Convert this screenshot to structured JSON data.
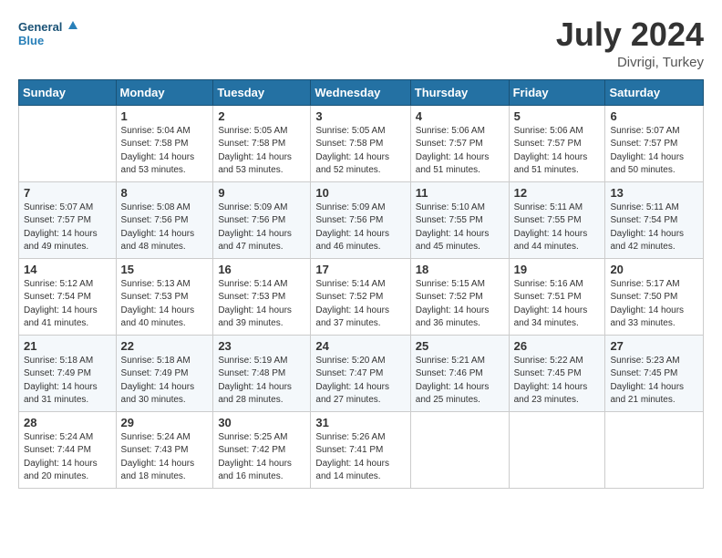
{
  "header": {
    "logo_line1": "General",
    "logo_line2": "Blue",
    "month_year": "July 2024",
    "location": "Divrigi, Turkey"
  },
  "weekdays": [
    "Sunday",
    "Monday",
    "Tuesday",
    "Wednesday",
    "Thursday",
    "Friday",
    "Saturday"
  ],
  "weeks": [
    [
      {
        "day": "",
        "info": ""
      },
      {
        "day": "1",
        "info": "Sunrise: 5:04 AM\nSunset: 7:58 PM\nDaylight: 14 hours\nand 53 minutes."
      },
      {
        "day": "2",
        "info": "Sunrise: 5:05 AM\nSunset: 7:58 PM\nDaylight: 14 hours\nand 53 minutes."
      },
      {
        "day": "3",
        "info": "Sunrise: 5:05 AM\nSunset: 7:58 PM\nDaylight: 14 hours\nand 52 minutes."
      },
      {
        "day": "4",
        "info": "Sunrise: 5:06 AM\nSunset: 7:57 PM\nDaylight: 14 hours\nand 51 minutes."
      },
      {
        "day": "5",
        "info": "Sunrise: 5:06 AM\nSunset: 7:57 PM\nDaylight: 14 hours\nand 51 minutes."
      },
      {
        "day": "6",
        "info": "Sunrise: 5:07 AM\nSunset: 7:57 PM\nDaylight: 14 hours\nand 50 minutes."
      }
    ],
    [
      {
        "day": "7",
        "info": "Sunrise: 5:07 AM\nSunset: 7:57 PM\nDaylight: 14 hours\nand 49 minutes."
      },
      {
        "day": "8",
        "info": "Sunrise: 5:08 AM\nSunset: 7:56 PM\nDaylight: 14 hours\nand 48 minutes."
      },
      {
        "day": "9",
        "info": "Sunrise: 5:09 AM\nSunset: 7:56 PM\nDaylight: 14 hours\nand 47 minutes."
      },
      {
        "day": "10",
        "info": "Sunrise: 5:09 AM\nSunset: 7:56 PM\nDaylight: 14 hours\nand 46 minutes."
      },
      {
        "day": "11",
        "info": "Sunrise: 5:10 AM\nSunset: 7:55 PM\nDaylight: 14 hours\nand 45 minutes."
      },
      {
        "day": "12",
        "info": "Sunrise: 5:11 AM\nSunset: 7:55 PM\nDaylight: 14 hours\nand 44 minutes."
      },
      {
        "day": "13",
        "info": "Sunrise: 5:11 AM\nSunset: 7:54 PM\nDaylight: 14 hours\nand 42 minutes."
      }
    ],
    [
      {
        "day": "14",
        "info": "Sunrise: 5:12 AM\nSunset: 7:54 PM\nDaylight: 14 hours\nand 41 minutes."
      },
      {
        "day": "15",
        "info": "Sunrise: 5:13 AM\nSunset: 7:53 PM\nDaylight: 14 hours\nand 40 minutes."
      },
      {
        "day": "16",
        "info": "Sunrise: 5:14 AM\nSunset: 7:53 PM\nDaylight: 14 hours\nand 39 minutes."
      },
      {
        "day": "17",
        "info": "Sunrise: 5:14 AM\nSunset: 7:52 PM\nDaylight: 14 hours\nand 37 minutes."
      },
      {
        "day": "18",
        "info": "Sunrise: 5:15 AM\nSunset: 7:52 PM\nDaylight: 14 hours\nand 36 minutes."
      },
      {
        "day": "19",
        "info": "Sunrise: 5:16 AM\nSunset: 7:51 PM\nDaylight: 14 hours\nand 34 minutes."
      },
      {
        "day": "20",
        "info": "Sunrise: 5:17 AM\nSunset: 7:50 PM\nDaylight: 14 hours\nand 33 minutes."
      }
    ],
    [
      {
        "day": "21",
        "info": "Sunrise: 5:18 AM\nSunset: 7:49 PM\nDaylight: 14 hours\nand 31 minutes."
      },
      {
        "day": "22",
        "info": "Sunrise: 5:18 AM\nSunset: 7:49 PM\nDaylight: 14 hours\nand 30 minutes."
      },
      {
        "day": "23",
        "info": "Sunrise: 5:19 AM\nSunset: 7:48 PM\nDaylight: 14 hours\nand 28 minutes."
      },
      {
        "day": "24",
        "info": "Sunrise: 5:20 AM\nSunset: 7:47 PM\nDaylight: 14 hours\nand 27 minutes."
      },
      {
        "day": "25",
        "info": "Sunrise: 5:21 AM\nSunset: 7:46 PM\nDaylight: 14 hours\nand 25 minutes."
      },
      {
        "day": "26",
        "info": "Sunrise: 5:22 AM\nSunset: 7:45 PM\nDaylight: 14 hours\nand 23 minutes."
      },
      {
        "day": "27",
        "info": "Sunrise: 5:23 AM\nSunset: 7:45 PM\nDaylight: 14 hours\nand 21 minutes."
      }
    ],
    [
      {
        "day": "28",
        "info": "Sunrise: 5:24 AM\nSunset: 7:44 PM\nDaylight: 14 hours\nand 20 minutes."
      },
      {
        "day": "29",
        "info": "Sunrise: 5:24 AM\nSunset: 7:43 PM\nDaylight: 14 hours\nand 18 minutes."
      },
      {
        "day": "30",
        "info": "Sunrise: 5:25 AM\nSunset: 7:42 PM\nDaylight: 14 hours\nand 16 minutes."
      },
      {
        "day": "31",
        "info": "Sunrise: 5:26 AM\nSunset: 7:41 PM\nDaylight: 14 hours\nand 14 minutes."
      },
      {
        "day": "",
        "info": ""
      },
      {
        "day": "",
        "info": ""
      },
      {
        "day": "",
        "info": ""
      }
    ]
  ]
}
